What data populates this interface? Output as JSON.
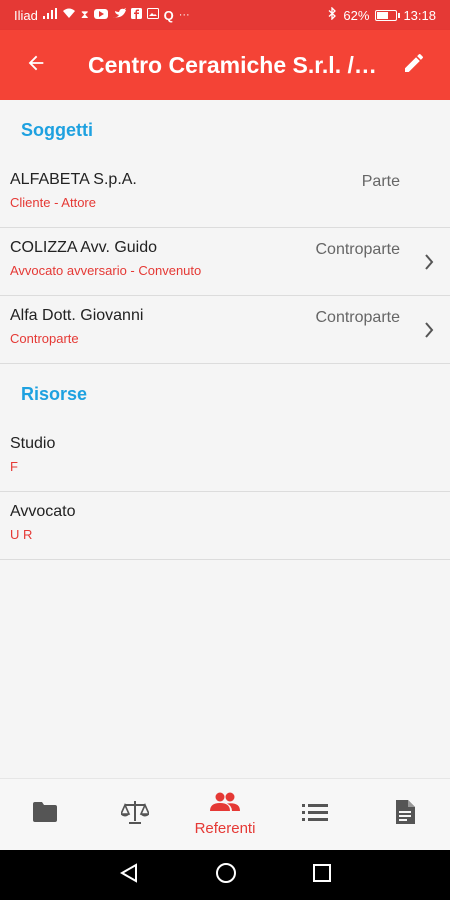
{
  "status_bar": {
    "carrier": "Iliad",
    "battery_percent": "62%",
    "battery_level": 0.62,
    "time": "13:18",
    "icons": [
      "signal-icon",
      "wifi-icon",
      "hourglass-icon",
      "youtube-icon",
      "twitter-icon",
      "facebook-icon",
      "photo-icon",
      "q-icon",
      "more-icon",
      "bluetooth-icon",
      "battery-icon"
    ]
  },
  "app_bar": {
    "title": "Centro Ceramiche S.r.l. /…",
    "back_icon": "arrow-back-icon",
    "edit_icon": "edit-pencil-icon"
  },
  "sections": {
    "soggetti": {
      "header": "Soggetti",
      "items": [
        {
          "title": "ALFABETA S.p.A.",
          "subtitle": "Cliente - Attore",
          "role": "Parte"
        },
        {
          "title": "COLIZZA Avv. Guido",
          "subtitle": "Avvocato avversario - Convenuto",
          "role": "Controparte"
        },
        {
          "title": "Alfa Dott. Giovanni",
          "subtitle": "Controparte",
          "role": "Controparte"
        }
      ]
    },
    "risorse": {
      "header": "Risorse",
      "items": [
        {
          "title": "Studio",
          "subtitle": "F"
        },
        {
          "title": "Avvocato",
          "subtitle": "U R"
        }
      ]
    }
  },
  "bottom_nav": {
    "active_label": "Referenti",
    "items": [
      "folder-icon",
      "scale-icon",
      "people-icon",
      "list-icon",
      "document-icon"
    ]
  },
  "colors": {
    "status_bar": "#e53935",
    "app_bar": "#f44336",
    "section_header": "#1ea1e0",
    "subtitle": "#e53935"
  }
}
